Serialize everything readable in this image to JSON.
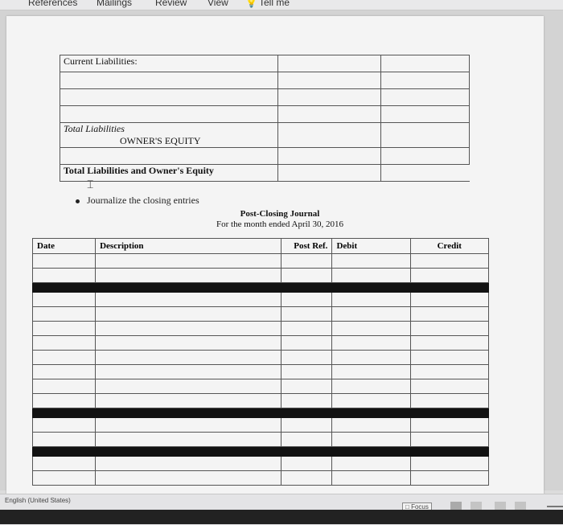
{
  "ribbon": {
    "tabs": [
      "References",
      "Mailings",
      "Review",
      "View",
      "Tell me"
    ]
  },
  "liabilities": {
    "current_label": "Current Liabilities:",
    "total_label": "Total Liabilities",
    "equity_label": "OWNER'S EQUITY",
    "total_liab_equity_label": "Total Liabilities and Owner's Equity"
  },
  "bullet_text": "Journalize the closing entries",
  "journal": {
    "title": "Post-Closing Journal",
    "subtitle": "For the month ended April 30, 2016",
    "headers": [
      "Date",
      "Description",
      "Post Ref.",
      "Debit",
      "Credit"
    ]
  },
  "status": {
    "language": "English (United States)",
    "focus_label": "Focus"
  },
  "colors": {
    "black_row": "#121212",
    "page": "#f4f4f4"
  }
}
